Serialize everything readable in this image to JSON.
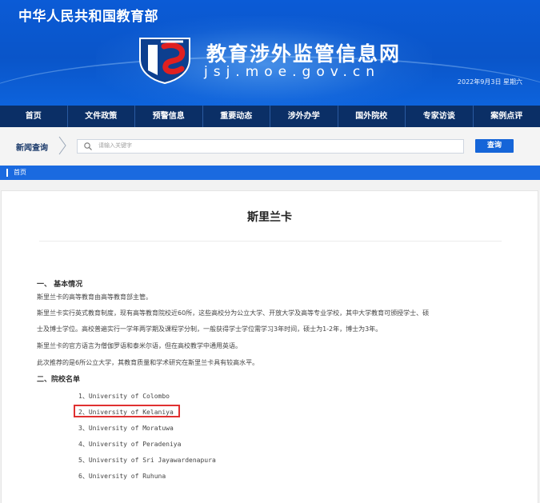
{
  "header": {
    "ministry": "中华人民共和国教育部",
    "site_title": "教育涉外监管信息网",
    "site_url": "jsj.moe.gov.cn",
    "date": "2022年9月3日 星期六"
  },
  "nav": {
    "items": [
      "首页",
      "文件政策",
      "预警信息",
      "重要动态",
      "涉外办学",
      "国外院校",
      "专家访谈",
      "案例点评"
    ]
  },
  "search": {
    "label": "新闻查询",
    "placeholder": "请输入关键字",
    "button": "查询"
  },
  "breadcrumb": {
    "home": "首页"
  },
  "article": {
    "title": "斯里兰卡",
    "section1": "一、 基本情况",
    "p1": "斯里兰卡的高等教育由高等教育部主管。",
    "p2a": "斯里兰卡实行英式教育制度，现有高等教育院校近60所，这些高校分为公立大学、开放大学及高等专业学校，其中大学教育可颁授学士、硕",
    "p2b": "士及博士学位。高校普遍实行一学年两学期及课程学分制，一般获得学士学位需学习3年时间，硕士为1-2年，博士为3年。",
    "p3": "斯里兰卡的官方语言为僧伽罗语和泰米尔语，但在高校教学中通用英语。",
    "p4": "此次推荐的是6所公立大学，其教育质量和学术研究在斯里兰卡具有较高水平。",
    "section2": "二、院校名单",
    "schools": [
      "1、University of Colombo",
      "2、University of Kelaniya",
      "3、University of Moratuwa",
      "4、University of Peradeniya",
      "5、University of Sri Jayawardenapura",
      "6、University of Ruhuna"
    ]
  },
  "colors": {
    "banner": "#0b5bd6",
    "nav": "#0b2f66",
    "accent": "#1565d8",
    "highlight": "#e03030"
  }
}
